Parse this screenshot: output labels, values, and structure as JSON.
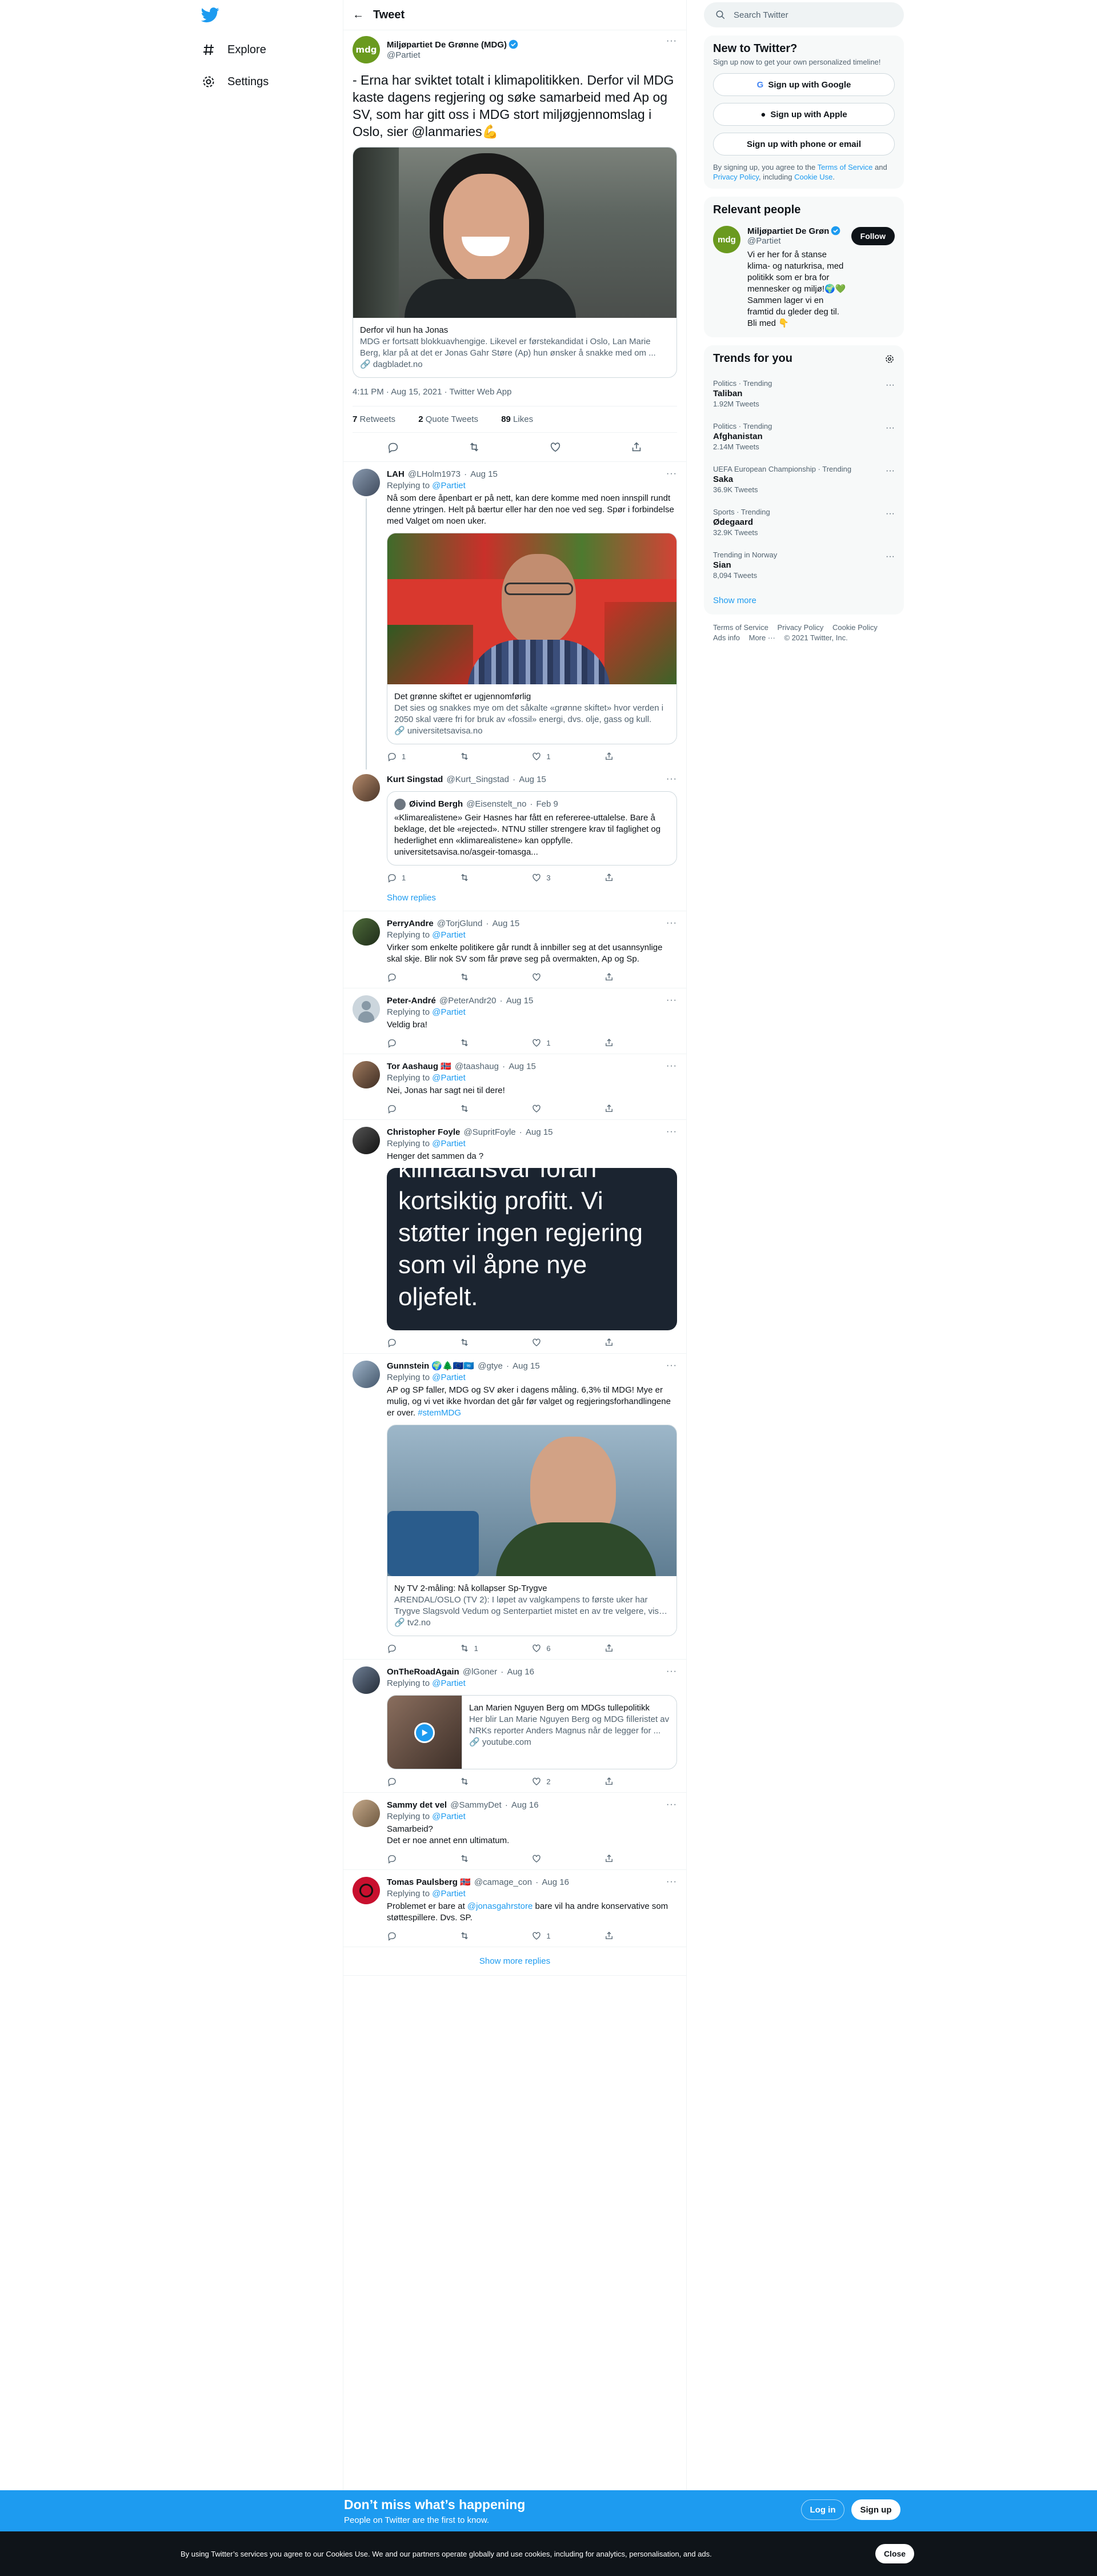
{
  "nav": {
    "explore": "Explore",
    "settings": "Settings"
  },
  "header": {
    "title": "Tweet"
  },
  "focal": {
    "name": "Miljøpartiet De Grønne (MDG)",
    "handle": "@Partiet",
    "text": "- Erna har sviktet totalt i klimapolitikken. Derfor vil MDG kaste dagens regjering og søke samarbeid med Ap og SV, som har gitt oss i MDG stort miljøgjennomslag i Oslo, sier @lanmaries💪",
    "card": {
      "title": "Derfor vil hun ha Jonas",
      "desc": "MDG er fortsatt blokkuavhengige. Likevel er førstekandidat i Oslo, Lan Marie Berg, klar på at det er Jonas Gahr Støre (Ap) hun ønsker å snakke med om ...",
      "url": "🔗 dagbladet.no"
    },
    "time": "4:11 PM · Aug 15, 2021 · Twitter Web App",
    "retweets": "7",
    "retweets_label": "Retweets",
    "quotes": "2",
    "quotes_label": "Quote Tweets",
    "likes": "89",
    "likes_label": "Likes"
  },
  "replying_to": "Replying to",
  "replies": [
    {
      "name": "LAH",
      "handle": "@LHolm1973",
      "date": "Aug 15",
      "to": "@Partiet",
      "text": "Nå som dere åpenbart er på nett, kan dere komme med noen innspill rundt denne ytringen. Helt på bærtur eller har den noe ved seg. Spør i forbindelse med Valget om noen uker.",
      "card_title": "Det grønne skiftet er ugjennomførlig",
      "card_desc": "Det sies og snakkes mye om det såkalte «grønne skiftet» hvor verden i 2050 skal være fri for bruk av «fossil» energi, dvs. olje, gass og kull.",
      "card_url": "🔗 universitetsavisa.no",
      "r": "1",
      "rt": "",
      "l": "1"
    },
    {
      "name": "Kurt Singstad",
      "handle": "@Kurt_Singstad",
      "date": "Aug 15",
      "quote_name": "Øivind Bergh",
      "quote_handle": "@Eisenstelt_no",
      "quote_date": "Feb 9",
      "quote_text": "«Klimarealistene» Geir Hasnes har fått en refereree-uttalelse. Bare å beklage, det ble «rejected». NTNU stiller strengere krav til faglighet og hederlighet enn «klimarealistene» kan oppfylle. universitetsavisa.no/asgeir-tomasga...",
      "r": "1",
      "rt": "",
      "l": "3",
      "show": "Show replies"
    },
    {
      "name": "PerryAndre",
      "handle": "@TorjGlund",
      "date": "Aug 15",
      "to": "@Partiet",
      "text": "Virker som enkelte politikere går rundt å innbiller seg at det usannsynlige skal skje. Blir nok SV som får prøve seg på overmakten, Ap og Sp.",
      "r": "",
      "rt": "",
      "l": ""
    },
    {
      "name": "Peter-André",
      "handle": "@PeterAndr20",
      "date": "Aug 15",
      "to": "@Partiet",
      "text": "Veldig bra!",
      "r": "",
      "rt": "",
      "l": "1"
    },
    {
      "name": "Tor Aashaug 🇳🇴",
      "handle": "@taashaug",
      "date": "Aug 15",
      "to": "@Partiet",
      "text": "Nei, Jonas har sagt nei til dere!",
      "r": "",
      "rt": "",
      "l": ""
    },
    {
      "name": "Christopher Foyle",
      "handle": "@SupritFoyle",
      "date": "Aug 15",
      "to": "@Partiet",
      "text": "Henger det sammen da ?",
      "media_text": "klimaansvar foran kortsiktig profitt. Vi støtter ingen regjering som vil åpne nye oljefelt.",
      "r": "",
      "rt": "",
      "l": ""
    },
    {
      "name": "Gunnstein 🌍🌲🇪🇺🇺🇳",
      "handle": "@gtye",
      "date": "Aug 15",
      "to": "@Partiet",
      "text": "AP og SP faller, MDG og SV øker i dagens måling. 6,3% til MDG! Mye er mulig, og vi vet ikke hvordan det går før valget og regjeringsforhandlingene er over.",
      "hashtag": "#stemMDG",
      "card_title": "Ny TV 2-måling: Nå kollapser Sp-Trygve",
      "card_desc": "ARENDAL/OSLO (TV 2): I løpet av valgkampens to første uker har Trygve Slagsvold Vedum og Senterpartiet mistet en av tre velgere, viser Kanta...",
      "card_url": "🔗 tv2.no",
      "r": "",
      "rt": "1",
      "l": "6"
    },
    {
      "name": "OnTheRoadAgain",
      "handle": "@lGoner",
      "date": "Aug 16",
      "to": "@Partiet",
      "card_title": "Lan Marien Nguyen Berg om MDGs tullepolitikk",
      "card_desc": "Her blir Lan Marie Nguyen Berg og MDG filleristet av NRKs reporter Anders Magnus når de legger for ...",
      "card_url": "🔗 youtube.com",
      "r": "",
      "rt": "",
      "l": "2"
    },
    {
      "name": "Sammy det vel",
      "handle": "@SammyDet",
      "date": "Aug 16",
      "to": "@Partiet",
      "text": "Samarbeid?\nDet er noe annet enn ultimatum.",
      "r": "",
      "rt": "",
      "l": ""
    },
    {
      "name": "Tomas Paulsberg 🇳🇴",
      "handle": "@camage_con",
      "date": "Aug 16",
      "to": "@Partiet",
      "text_pre": "Problemet er bare at ",
      "mention": "@jonasgahrstore",
      "text_post": " bare vil ha andre konservative som støttespillere. Dvs. SP.",
      "r": "",
      "rt": "",
      "l": "1"
    }
  ],
  "show_more": "Show more replies",
  "side": {
    "search_placeholder": "Search Twitter",
    "new_title": "New to Twitter?",
    "new_sub": "Sign up now to get your own personalized timeline!",
    "google": "Sign up with Google",
    "apple": "Sign up with Apple",
    "phone": "Sign up with phone or email",
    "terms_pre": "By signing up, you agree to the ",
    "terms_link": "Terms of Service",
    "terms_mid": " and ",
    "privacy_link": "Privacy Policy",
    "terms_mid2": ", including ",
    "cookie_link": "Cookie Use",
    "terms_end": ".",
    "relevant_title": "Relevant people",
    "rel_name": "Miljøpartiet De Grøn",
    "rel_handle": "@Partiet",
    "rel_follow": "Follow",
    "rel_bio": "Vi er her for å stanse klima- og naturkrisa, med politikk som er bra for mennesker og miljø!🌍💚 Sammen lager vi en framtid du gleder deg til. Bli med 👇",
    "trends_title": "Trends for you",
    "trends": [
      {
        "meta": "Politics · Trending",
        "name": "Taliban",
        "count": "1.92M Tweets"
      },
      {
        "meta": "Politics · Trending",
        "name": "Afghanistan",
        "count": "2.14M Tweets"
      },
      {
        "meta": "UEFA European Championship · Trending",
        "name": "Saka",
        "count": "36.9K Tweets"
      },
      {
        "meta": "Sports · Trending",
        "name": "Ødegaard",
        "count": "32.9K Tweets"
      },
      {
        "meta": "Trending in Norway",
        "name": "Sian",
        "count": "8,094 Tweets"
      }
    ],
    "show_more": "Show more",
    "footer": {
      "l1": "Terms of Service",
      "l2": "Privacy Policy",
      "l3": "Cookie Policy",
      "l4": "Ads info",
      "l5": "More ···",
      "l6": "© 2021 Twitter, Inc."
    }
  },
  "banner": {
    "title": "Don’t miss what’s happening",
    "sub": "People on Twitter are the first to know.",
    "login": "Log in",
    "signup": "Sign up"
  },
  "cookie": {
    "text": "By using Twitter’s services you agree to our Cookies Use. We and our partners operate globally and use cookies, including for analytics, personalisation, and ads.",
    "close": "Close"
  },
  "colors": {
    "accent": "#1d9bf0",
    "mdg_green": "#6a9a1f"
  }
}
